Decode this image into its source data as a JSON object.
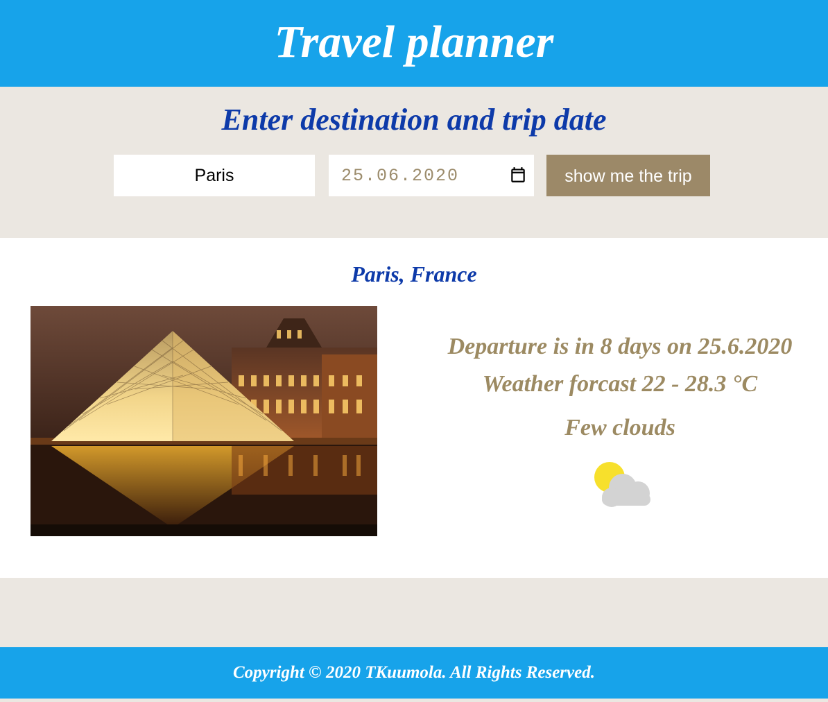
{
  "header": {
    "title": "Travel planner"
  },
  "form": {
    "heading": "Enter destination and trip date",
    "destination_value": "Paris",
    "date_value": "25.06.2020",
    "submit_label": "show me the trip"
  },
  "result": {
    "location": "Paris, France",
    "image_icon": "louvre-pyramid-photo",
    "departure": "Departure is in 8 days on 25.6.2020",
    "forecast": "Weather forcast 22 - 28.3 °C",
    "description": "Few clouds",
    "weather_icon": "partly-cloudy-icon"
  },
  "footer": {
    "copyright": "Copyright © 2020 TKuumola. All Rights Reserved."
  },
  "colors": {
    "header_bg": "#17a3ea",
    "section_bg": "#ebe7e1",
    "accent_blue": "#0d3aa9",
    "accent_tan": "#9c8968"
  }
}
